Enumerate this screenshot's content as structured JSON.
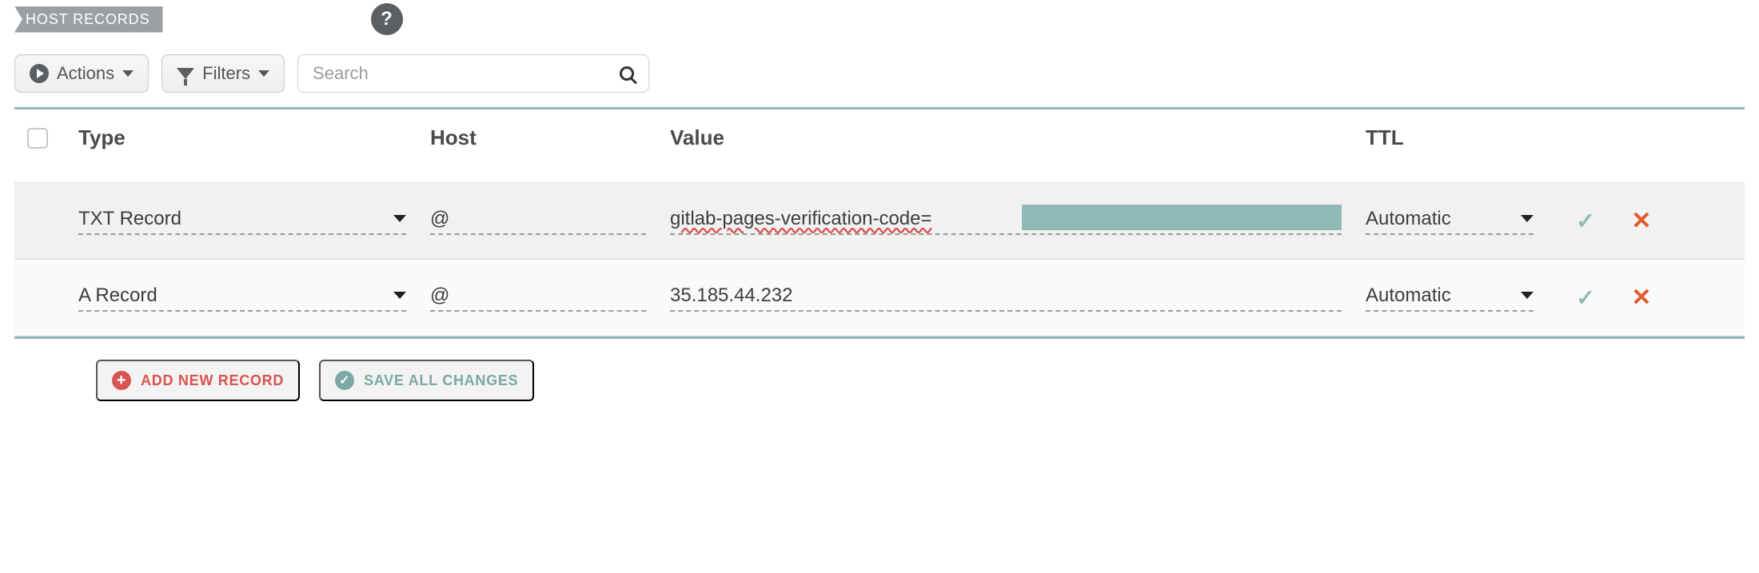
{
  "header": {
    "tab_label": "HOST RECORDS",
    "help_tooltip": "?"
  },
  "toolbar": {
    "actions_label": "Actions",
    "filters_label": "Filters",
    "search_placeholder": "Search"
  },
  "columns": {
    "type": "Type",
    "host": "Host",
    "value": "Value",
    "ttl": "TTL"
  },
  "records": [
    {
      "type": "TXT Record",
      "host": "@",
      "value": "gitlab-pages-verification-code=",
      "value_redacted": true,
      "squiggled": true,
      "ttl": "Automatic"
    },
    {
      "type": "A Record",
      "host": "@",
      "value": "35.185.44.232",
      "value_redacted": false,
      "squiggled": false,
      "ttl": "Automatic"
    }
  ],
  "footer": {
    "add_label": "ADD NEW RECORD",
    "save_label": "SAVE ALL CHANGES"
  },
  "colors": {
    "accent_teal": "#8fbab6",
    "accent_orange": "#e25a2b",
    "danger": "#d9534f"
  }
}
